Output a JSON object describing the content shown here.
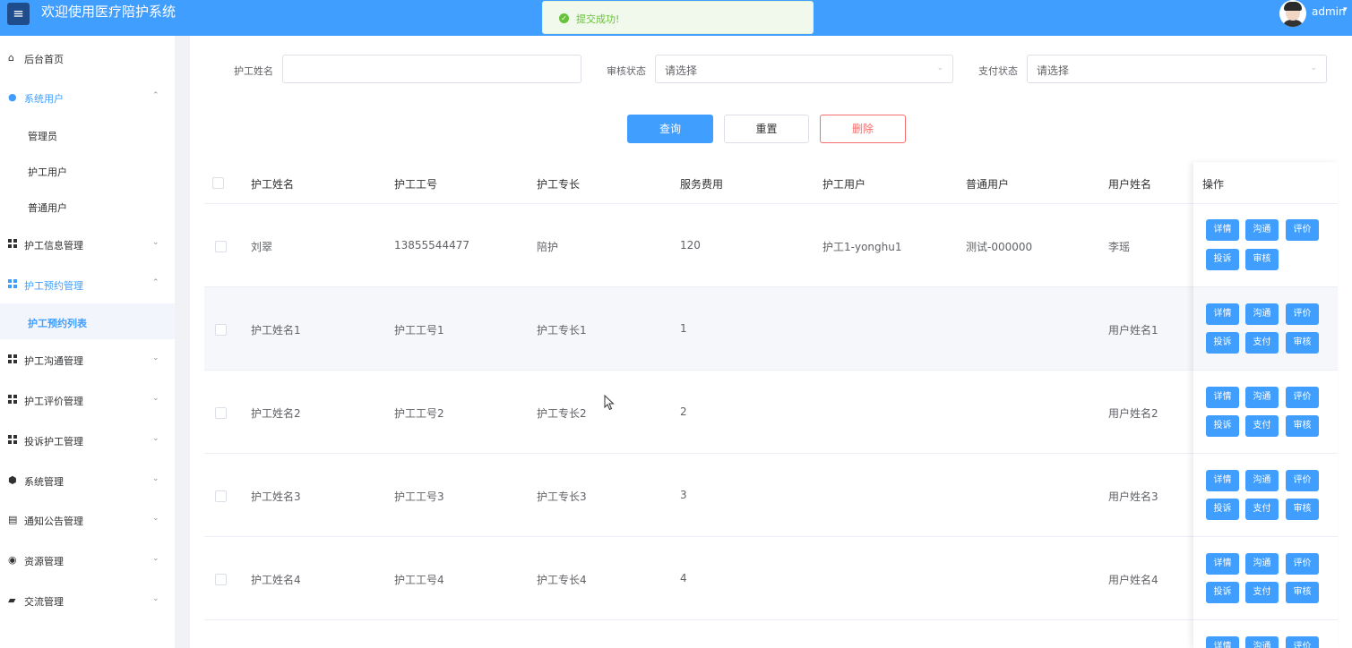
{
  "header": {
    "menu_icon": "hamburger-icon",
    "title": "欢迎使用医疗陪护系统",
    "user": "admin"
  },
  "toast": {
    "icon": "success-check-icon",
    "text": "提交成功!"
  },
  "sidebar": {
    "home": {
      "label": "后台首页",
      "icon": "home-icon"
    },
    "system_users": {
      "label": "系统用户",
      "icon": "user-icon"
    },
    "system_users_children": [
      "管理员",
      "护工用户",
      "普通用户"
    ],
    "nurse_info": "护工信息管理",
    "booking": "护工预约管理",
    "booking_children": [
      "护工预约列表"
    ],
    "chat": "护工沟通管理",
    "review": "护工评价管理",
    "complaint": "投诉护工管理",
    "system": {
      "label": "系统管理",
      "icon": "gear-icon"
    },
    "notice": {
      "label": "通知公告管理",
      "icon": "document-icon"
    },
    "resource": {
      "label": "资源管理",
      "icon": "compass-icon"
    },
    "exchange": {
      "label": "交流管理",
      "icon": "message-icon"
    }
  },
  "filters": {
    "name_label": "护工姓名",
    "name_value": "",
    "audit_label": "审核状态",
    "audit_value": "请选择",
    "pay_label": "支付状态",
    "pay_value": "请选择"
  },
  "buttons": {
    "search": "查询",
    "reset": "重置",
    "delete": "删除"
  },
  "table": {
    "headers": [
      "护工姓名",
      "护工工号",
      "护工专长",
      "服务费用",
      "护工用户",
      "普通用户",
      "用户姓名",
      "操作"
    ],
    "rows": [
      {
        "name": "刘翠",
        "no": "13855544477",
        "skill": "陪护",
        "fee": "120",
        "nurse_user": "护工1-yonghu1",
        "normal_user": "测试-000000",
        "user_name": "李瑶"
      },
      {
        "name": "护工姓名1",
        "no": "护工工号1",
        "skill": "护工专长1",
        "fee": "1",
        "nurse_user": "",
        "normal_user": "",
        "user_name": "用户姓名1"
      },
      {
        "name": "护工姓名2",
        "no": "护工工号2",
        "skill": "护工专长2",
        "fee": "2",
        "nurse_user": "",
        "normal_user": "",
        "user_name": "用户姓名2"
      },
      {
        "name": "护工姓名3",
        "no": "护工工号3",
        "skill": "护工专长3",
        "fee": "3",
        "nurse_user": "",
        "normal_user": "",
        "user_name": "用户姓名3"
      },
      {
        "name": "护工姓名4",
        "no": "护工工号4",
        "skill": "护工专长4",
        "fee": "4",
        "nurse_user": "",
        "normal_user": "",
        "user_name": "用户姓名4"
      }
    ],
    "actions": {
      "detail": "详情",
      "chat": "沟通",
      "review": "评价",
      "complain": "投诉",
      "pay": "支付",
      "audit": "审核"
    }
  },
  "colors": {
    "primary": "#409eff",
    "danger": "#f56c6c",
    "success": "#67c23a"
  }
}
